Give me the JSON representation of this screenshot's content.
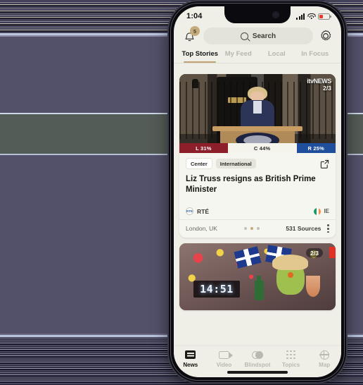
{
  "status_bar": {
    "clock": "1:04",
    "icons": {
      "signal": "cellular-signal-icon",
      "wifi": "wifi-icon",
      "battery": "battery-low-icon"
    }
  },
  "header": {
    "notifications_badge": "5",
    "search_placeholder": "Search",
    "settings_label": "Settings"
  },
  "tabs": [
    {
      "label": "Top Stories",
      "active": true
    },
    {
      "label": "My Feed",
      "active": false
    },
    {
      "label": "Local",
      "active": false
    },
    {
      "label": "In Focus",
      "active": false
    }
  ],
  "cards": [
    {
      "image_watermark": "itvNEWS",
      "image_counter": "2/3",
      "bias": {
        "left_label": "L 31%",
        "left_pct": 31,
        "left_color": "#8c1f2a",
        "center_label": "C 44%",
        "center_pct": 44,
        "center_color": "#f4f3ec",
        "right_label": "R 25%",
        "right_pct": 25,
        "right_color": "#1f4f9c"
      },
      "tags": [
        "Center",
        "International"
      ],
      "headline": "Liz Truss resigns as British Prime Minister",
      "source_logo": "RTE",
      "source_name": "RTÉ",
      "country_code": "IE",
      "location": "London, UK",
      "sources_count": "531 Sources",
      "dot_count": 3,
      "active_dot": 2
    },
    {
      "image_counter": "2/3",
      "clock_display": "14:51"
    }
  ],
  "bottom_nav": [
    {
      "label": "News",
      "icon": "news-icon",
      "active": true
    },
    {
      "label": "Video",
      "icon": "video-icon",
      "active": false
    },
    {
      "label": "Blindspot",
      "icon": "blindspot-icon",
      "active": false
    },
    {
      "label": "Topics",
      "icon": "topics-icon",
      "active": false
    },
    {
      "label": "Map",
      "icon": "map-icon",
      "active": false
    }
  ],
  "colors": {
    "accent": "#bfa377",
    "badge": "#c4ab7e",
    "screen_bg": "#efefe8",
    "card_bg": "#f6f6f0"
  }
}
